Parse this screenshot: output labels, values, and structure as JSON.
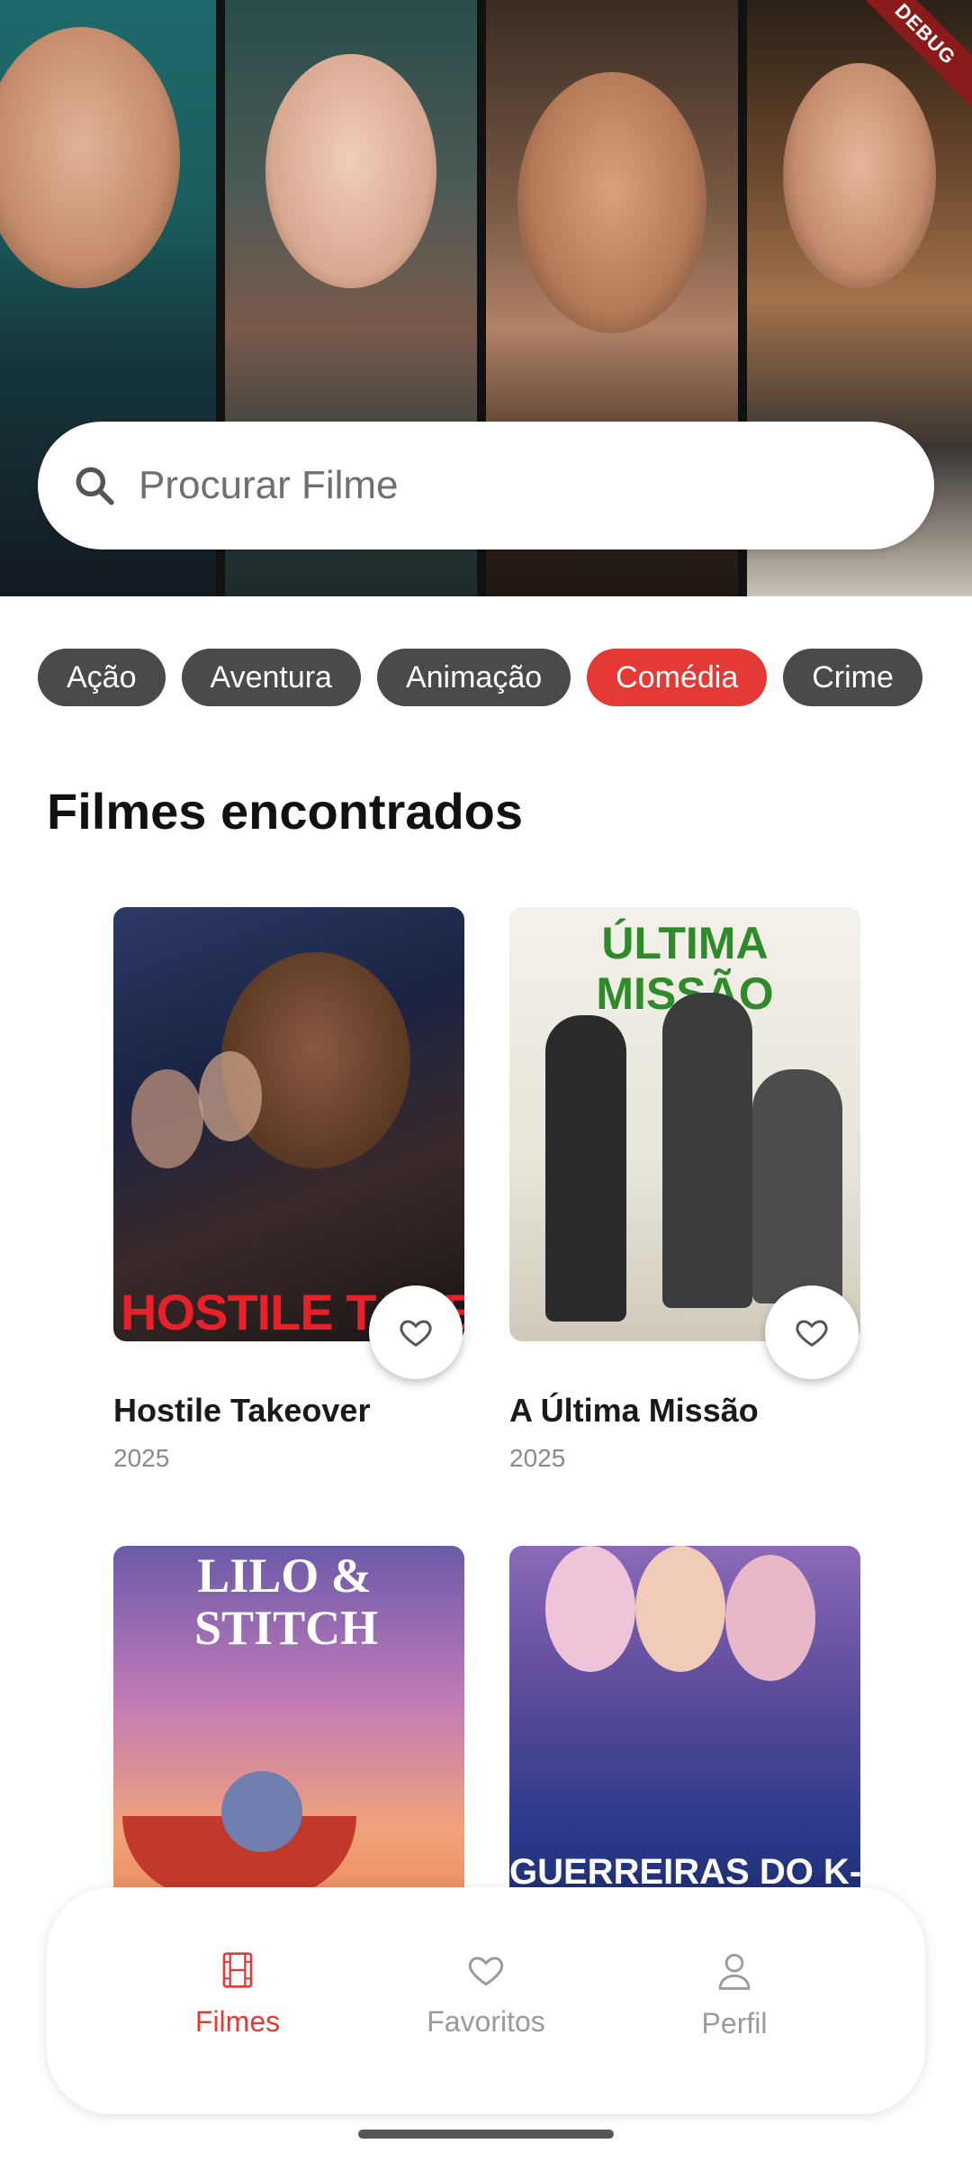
{
  "debug_banner": "DEBUG",
  "search": {
    "placeholder": "Procurar Filme",
    "icon": "search-icon"
  },
  "genres": [
    {
      "label": "Ação",
      "active": false
    },
    {
      "label": "Aventura",
      "active": false
    },
    {
      "label": "Animação",
      "active": false
    },
    {
      "label": "Comédia",
      "active": true
    },
    {
      "label": "Crime",
      "active": false
    }
  ],
  "section_title": "Filmes encontrados",
  "movies": [
    {
      "title": "Hostile Takeover",
      "year": "2025",
      "poster_text": "HOSTILE TAKEOVER",
      "favorite_icon": "heart-outline-icon"
    },
    {
      "title": "A Última Missão",
      "year": "2025",
      "poster_text": "ÚLTIMA MISSÃO",
      "favorite_icon": "heart-outline-icon"
    },
    {
      "poster_text": "LILO & STITCH"
    },
    {
      "poster_text": "GUERREIRAS DO K-POP"
    }
  ],
  "bottom_nav": [
    {
      "label": "Filmes",
      "icon": "film-icon",
      "active": true
    },
    {
      "label": "Favoritos",
      "icon": "heart-icon",
      "active": false
    },
    {
      "label": "Perfil",
      "icon": "person-icon",
      "active": false
    }
  ],
  "colors": {
    "accent": "#e53935",
    "chip": "#4a4a4a",
    "nav_inactive": "#9a9a9a"
  }
}
